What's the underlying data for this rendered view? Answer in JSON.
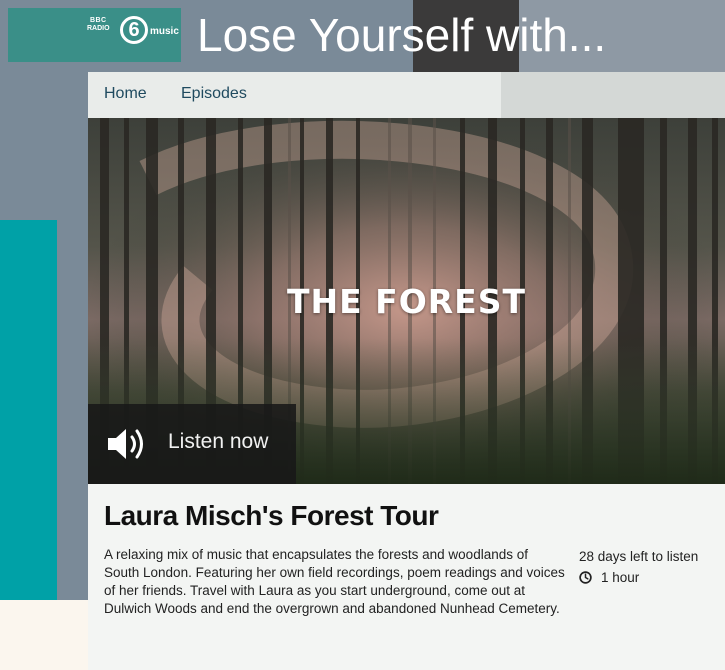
{
  "brand": {
    "bbc_line1": "BBC",
    "bbc_line2": "RADIO",
    "number": "6",
    "station_word": "music"
  },
  "headline": "Lose Yourself with...",
  "nav": {
    "items": [
      {
        "label": "Home"
      },
      {
        "label": "Episodes"
      }
    ]
  },
  "hero": {
    "title": "THE FOREST",
    "listen_label": "Listen now",
    "listen_icon": "speaker-icon"
  },
  "episode": {
    "title": "Laura Misch's Forest Tour",
    "description": "A relaxing mix of music that encapsulates the forests and woodlands of South London. Featuring her own field recordings, poem readings and voices of her friends. Travel with Laura as you start underground, come out at Dulwich Woods and end the overgrown and abandoned Nunhead Cemetery.",
    "availability": "28 days left to listen",
    "duration": "1 hour",
    "duration_icon": "clock-icon"
  },
  "colors": {
    "logo_bg": "#3a8f88",
    "teal_strip": "#00a1a7",
    "nav_text": "#1f4a5f",
    "listen_box": "#181818"
  }
}
